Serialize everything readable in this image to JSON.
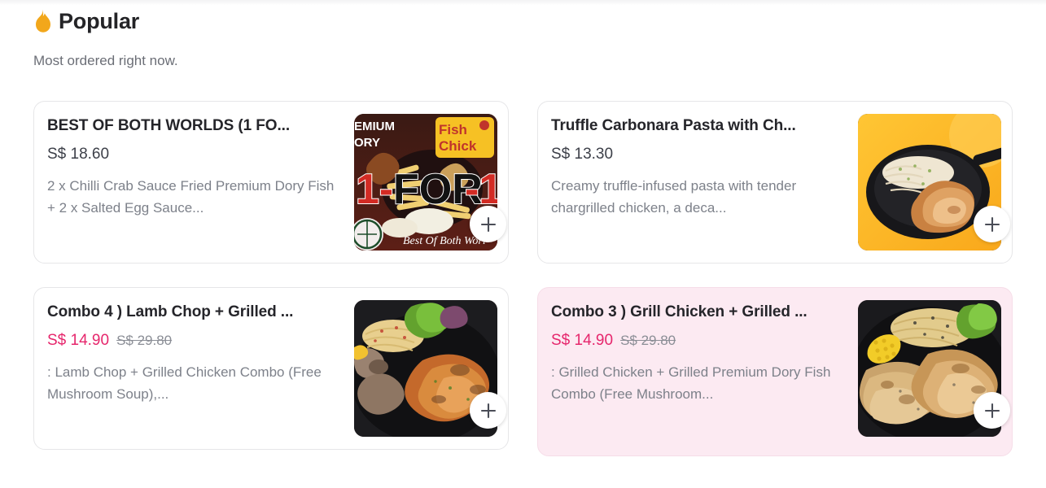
{
  "section": {
    "icon": "flame-icon",
    "title": "Popular",
    "subtitle": "Most ordered right now.",
    "accent_flame": "#F2A71B",
    "discount_color": "#E6266C",
    "promo_card_bg": "#FCEAF2"
  },
  "items": [
    {
      "title": "BEST OF BOTH WORLDS   (1 FO...",
      "price": "S$ 18.60",
      "original_price": "",
      "description": "2 x Chilli Crab Sauce Fried Premium Dory Fish + 2 x Salted Egg Sauce...",
      "image_alt": "1-FOR-1 Fish & Chick promotional banner with fried dory fish and fries",
      "promo": false,
      "add_label": "+"
    },
    {
      "title": "Truffle Carbonara Pasta with Ch...",
      "price": "S$ 13.30",
      "original_price": "",
      "description": "Creamy truffle-infused pasta with tender chargrilled chicken, a deca...",
      "image_alt": "Black skillet of creamy carbonara pasta with grilled chicken on orange background",
      "promo": false,
      "add_label": "+"
    },
    {
      "title": "Combo 4 )   Lamb Chop + Grilled ...",
      "price": "S$ 14.90",
      "original_price": "S$ 29.80",
      "description": ": Lamb Chop + Grilled Chicken Combo (Free Mushroom Soup),...",
      "image_alt": "Lamb chop and grilled chicken with pasta and lettuce on a black plate",
      "promo": false,
      "add_label": "+"
    },
    {
      "title": "Combo 3 ) Grill Chicken + Grilled ...",
      "price": "S$ 14.90",
      "original_price": "S$ 29.80",
      "description": ": Grilled Chicken + Grilled Premium Dory Fish Combo (Free Mushroom...",
      "image_alt": "Grilled chicken and dory fish with corn and pasta on a black plate",
      "promo": true,
      "add_label": "+"
    }
  ]
}
